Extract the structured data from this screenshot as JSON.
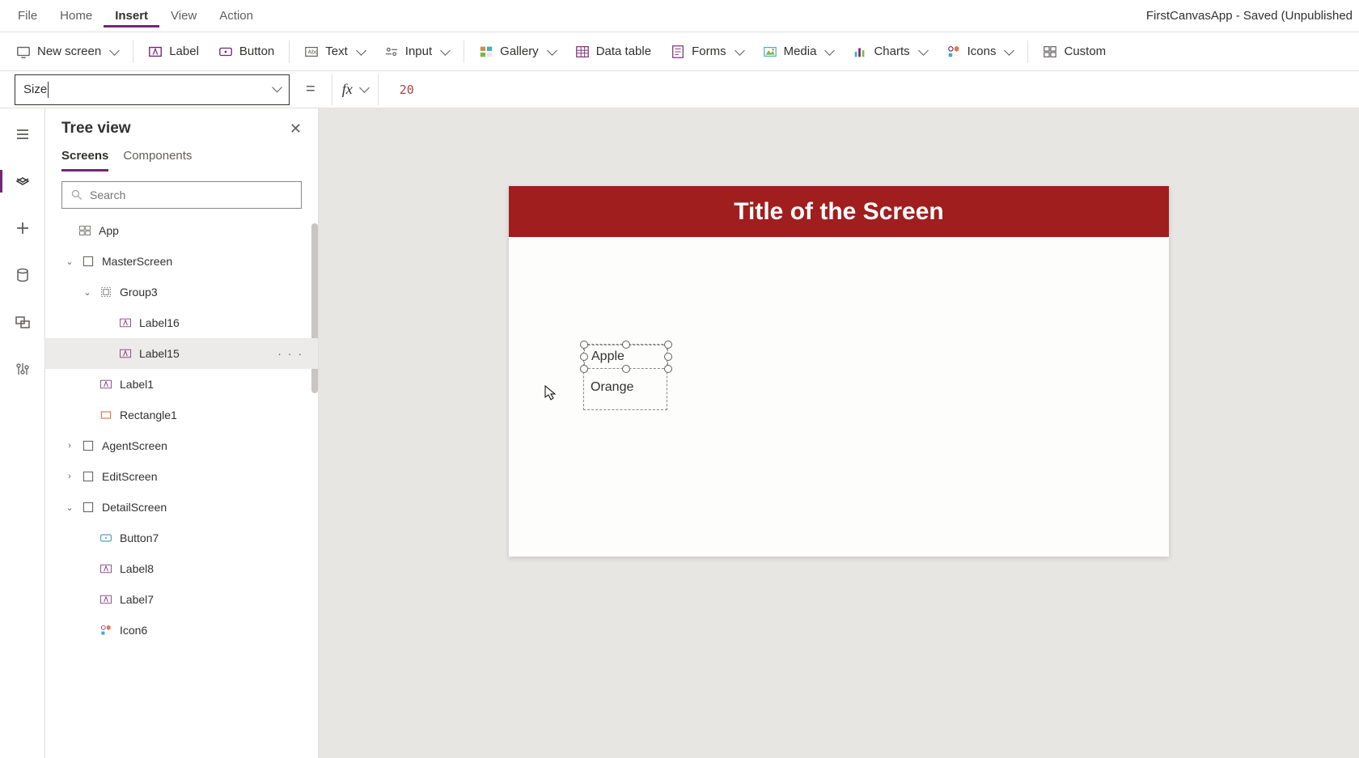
{
  "menu": {
    "file": "File",
    "home": "Home",
    "insert": "Insert",
    "view": "View",
    "action": "Action",
    "title": "FirstCanvasApp - Saved (Unpublished"
  },
  "ribbon": {
    "new_screen": "New screen",
    "label": "Label",
    "button": "Button",
    "text": "Text",
    "input": "Input",
    "gallery": "Gallery",
    "data_table": "Data table",
    "forms": "Forms",
    "media": "Media",
    "charts": "Charts",
    "icons": "Icons",
    "custom": "Custom"
  },
  "formula_bar": {
    "property": "Size",
    "eq": "=",
    "fx": "fx",
    "value": "20"
  },
  "tree": {
    "title": "Tree view",
    "tabs": {
      "screens": "Screens",
      "components": "Components"
    },
    "search_placeholder": "Search",
    "nodes": {
      "app": "App",
      "masterscreen": "MasterScreen",
      "group3": "Group3",
      "label16": "Label16",
      "label15": "Label15",
      "label1": "Label1",
      "rectangle1": "Rectangle1",
      "agentscreen": "AgentScreen",
      "editscreen": "EditScreen",
      "detailscreen": "DetailScreen",
      "button7": "Button7",
      "label8": "Label8",
      "label7": "Label7",
      "icon6": "Icon6"
    },
    "more": "· · ·"
  },
  "canvas": {
    "title": "Title of the Screen",
    "apple": "Apple",
    "orange": "Orange"
  }
}
